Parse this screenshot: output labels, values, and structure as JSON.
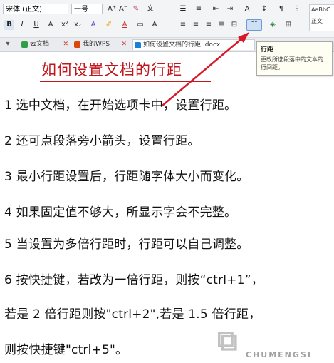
{
  "toolbar": {
    "font_name": "宋体 (正文)",
    "font_size": "一号",
    "style_preview": "AaBbC",
    "style_preview_label": "正文"
  },
  "tabs": [
    {
      "label": "云文档",
      "color": "#2f9e44"
    },
    {
      "label": "我的WPS",
      "color": "#d9480f"
    },
    {
      "label": "如何设置文档的行距 .docx",
      "color": "#1c7ed6"
    }
  ],
  "tooltip": {
    "title": "行距",
    "description": "更改所选段落中的文本的行间距。"
  },
  "document": {
    "heading": "如何设置文档的行距",
    "paragraphs": [
      "1 选中文档，在开始选项卡中，设置行距。",
      "2 还可点段落旁小箭头，设置行距。",
      "3 最小行距设置后，行距随字体大小而变化。",
      "4 如果固定值不够大，所显示字会不完整。",
      "5 当设置为多倍行距时，行距可以自己调整。",
      "6 按快捷键，若改为一倍行距，则按“ctrl+1”，",
      "若是 2 倍行距则按\"ctrl+2\",若是 1.5 倍行距，",
      "则按快捷键\"ctrl+5\"。"
    ]
  },
  "watermark": {
    "text": "CHUMENGSI"
  },
  "colors": {
    "heading": "#c0161d",
    "arrow": "#d7192a",
    "toolbar_bg": "#f3f4f6"
  }
}
